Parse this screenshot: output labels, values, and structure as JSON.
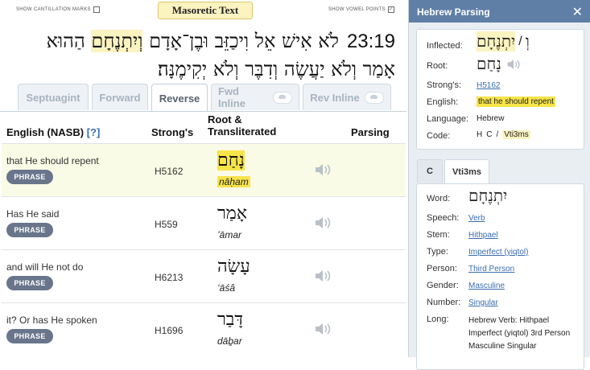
{
  "topbar": {
    "cantillation_label": "SHOW CANTILLATION MARKS",
    "vowel_label": "SHOW VOWEL POINTS",
    "title_button": "Masoretic Text"
  },
  "verse": {
    "number": "23:19",
    "line1_before": "לֹא אִישׁ אֵל וִיכַזֵּב וּבֶן־אָדָם ",
    "line1_highlight": "וְיִתְנֶחָם",
    "line1_after": " הַהוּא",
    "line2": "אָמַר וְלֹא יַעֲשֶׂה וְדִבֶּר וְלֹא יְקִימֶנָּה׃"
  },
  "tabs": [
    "Septuagint",
    "Forward",
    "Reverse",
    "Fwd Inline",
    "Rev Inline"
  ],
  "columns": {
    "english": "English (NASB)",
    "help": "[?]",
    "strongs": "Strong's",
    "root": "Root &",
    "translit": "Transliterated",
    "parsing": "Parsing"
  },
  "rows": [
    {
      "english": "that He should repent",
      "phrase": "PHRASE",
      "strongs": "H5162",
      "hebrew": "נָחַם",
      "translit": "nāḥam"
    },
    {
      "english": "Has He said",
      "phrase": "PHRASE",
      "strongs": "H559",
      "hebrew": "אָמַר",
      "translit": "’āmar"
    },
    {
      "english": "and will He not do",
      "phrase": "PHRASE",
      "strongs": "H6213",
      "hebrew": "עָשָׂה",
      "translit": "‘āśâ"
    },
    {
      "english": "it? Or has He spoken",
      "phrase": "PHRASE",
      "strongs": "H1696",
      "hebrew": "דָּבַר",
      "translit": "dāḇar"
    }
  ],
  "sidebar": {
    "title": "Hebrew Parsing",
    "close": "✕",
    "inflected_label": "Inflected:",
    "inflected_value": "יִתְנֶחָם",
    "inflected_prefix": "וְ",
    "inflected_sep": "/",
    "root_label": "Root:",
    "root_value": "נָחַם",
    "strongs_label": "Strong's:",
    "strongs_value": "H5162",
    "english_label": "English:",
    "english_value": "that he should repent",
    "language_label": "Language:",
    "language_value": "Hebrew",
    "code_label": "Code:",
    "code_h": "H",
    "code_c": "C",
    "code_sep": "/",
    "code_v": "Vti3ms",
    "tab_c": "C",
    "tab_v": "Vti3ms",
    "word_label": "Word:",
    "word_value": "יִתְנֶחָם",
    "speech_label": "Speech:",
    "speech_value": "Verb",
    "stem_label": "Stem:",
    "stem_value": "Hithpael",
    "type_label": "Type:",
    "type_value": "Imperfect (yiqtol)",
    "person_label": "Person:",
    "person_value": "Third Person",
    "gender_label": "Gender:",
    "gender_value": "Masculine",
    "number_label": "Number:",
    "number_value": "Singular",
    "long_label": "Long:",
    "long_value": "Hebrew Verb: Hithpael Imperfect (yiqtol) 3rd Person Masculine Singular"
  }
}
